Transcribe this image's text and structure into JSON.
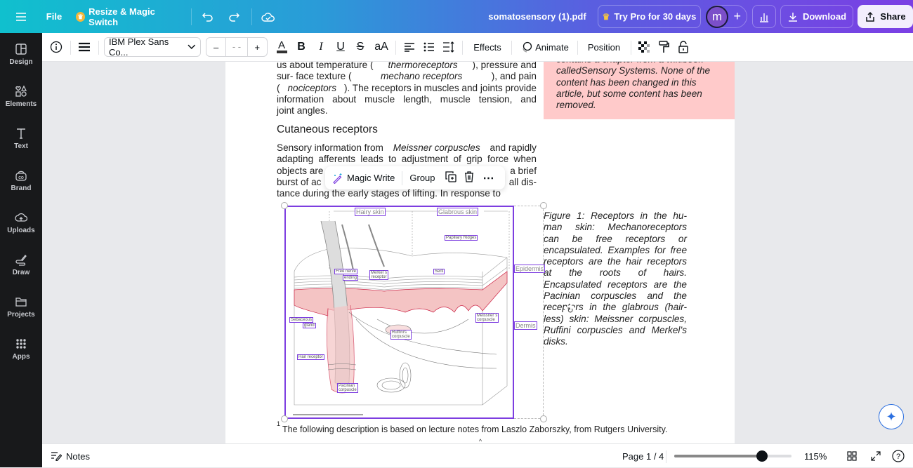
{
  "topbar": {
    "menu_icon": "hamburger-icon",
    "file": "File",
    "resize": "Resize & Magic Switch",
    "doc_title": "somatosensory (1).pdf",
    "try_pro": "Try Pro for 30 days",
    "avatar": "m",
    "download": "Download",
    "share": "Share"
  },
  "sidebar": {
    "items": [
      {
        "label": "Design",
        "icon": "layout-icon"
      },
      {
        "label": "Elements",
        "icon": "shapes-icon"
      },
      {
        "label": "Text",
        "icon": "text-icon"
      },
      {
        "label": "Brand",
        "icon": "brand-icon"
      },
      {
        "label": "Uploads",
        "icon": "cloud-upload-icon"
      },
      {
        "label": "Draw",
        "icon": "draw-icon"
      },
      {
        "label": "Projects",
        "icon": "folder-icon"
      },
      {
        "label": "Apps",
        "icon": "apps-grid-icon"
      }
    ]
  },
  "toolbar": {
    "font": "IBM Plex Sans Co...",
    "font_size": "- -",
    "minus": "–",
    "plus": "+",
    "bold": "B",
    "italic": "I",
    "underline": "U",
    "strike": "S",
    "case": "aA",
    "effects": "Effects",
    "animate": "Animate",
    "position": "Position"
  },
  "document": {
    "para1": [
      [
        [
          "us about temperature (",
          0
        ],
        [
          "thermoreceptors",
          1
        ],
        [
          "), pressure and",
          0
        ]
      ],
      [
        [
          "sur- face texture (",
          0
        ],
        [
          "mechano receptors",
          1
        ],
        [
          "), and pain",
          0
        ]
      ],
      [
        [
          "(",
          0
        ],
        [
          "nociceptors",
          1
        ],
        [
          "). The receptors in muscles and joints provide",
          0
        ]
      ],
      [
        [
          "information about muscle length, muscle tension, and",
          0
        ]
      ],
      [
        [
          "joint angles.",
          0
        ]
      ]
    ],
    "heading": "Cutaneous receptors",
    "para2": [
      [
        [
          "Sensory information from ",
          0
        ],
        [
          "Meissner corpuscles",
          1
        ],
        [
          " and rapidly",
          0
        ]
      ],
      [
        [
          "adapting afferents leads to adjustment of grip force when",
          0
        ]
      ],
      [
        [
          "objects are",
          0
        ],
        [
          "a brief",
          0
        ]
      ],
      [
        [
          "burst of ac",
          0
        ],
        [
          "all dis-",
          0
        ]
      ],
      [
        [
          "tance during the early stages of lifting. In response to",
          0
        ]
      ]
    ],
    "note_lines": [
      "contains a chapter from a wikibook",
      "calledSensory Systems. None of the",
      "content has been changed in this",
      "article, but some content has been",
      "removed."
    ],
    "caption_lines": [
      "Figure 1: Receptors in the hu-",
      "man skin: Mechanoreceptors",
      "can be free receptors or",
      "encapsulated. Examples for free",
      "receptors are the hair receptors",
      "at the roots of hairs.",
      "Encapsulated receptors are the",
      "Pacinian corpuscles and the",
      "receptors in the glabrous (hair-",
      "less) skin: Meissner corpuscles,",
      "Ruffini corpuscles and Merkel’s",
      "disks."
    ],
    "footnote_mark": "1",
    "footnote": "The following description is based on lecture notes from Laszlo Zaborszky, from Rutgers University."
  },
  "diagram_labels": {
    "hairy_skin": "Hairy skin",
    "glabrous_skin": "Glabrous skin",
    "papillary": "Papillary Ridges",
    "free_nerve_1": "Free nerve",
    "free_nerve_2": "ending",
    "merkel_1": "Merkel´s",
    "merkel_2": "receptor",
    "sweat": "Sent",
    "epidermis": "Epidermis",
    "sebaceous_1": "Sebaceous",
    "sebaceous_2": "gland",
    "meissner_1": "Meissner´s",
    "meissner_2": "corpuscle",
    "dermis": "Dermis",
    "ruffini_1": "Ruffini's",
    "ruffini_2": "corpuscle",
    "hair_receptor": "Hair receptor",
    "pacinian_1": "Pacinian",
    "pacinian_2": "corpuscle"
  },
  "float_toolbar": {
    "magic_write": "Magic Write",
    "group": "Group"
  },
  "bottombar": {
    "notes": "Notes",
    "page": "Page 1 / 4",
    "zoom": "115%",
    "zoom_slider_percent": 75
  },
  "colors": {
    "accent": "#7d3ee0",
    "note_bg": "#ffcaca",
    "sidebar_bg": "#18191b"
  }
}
